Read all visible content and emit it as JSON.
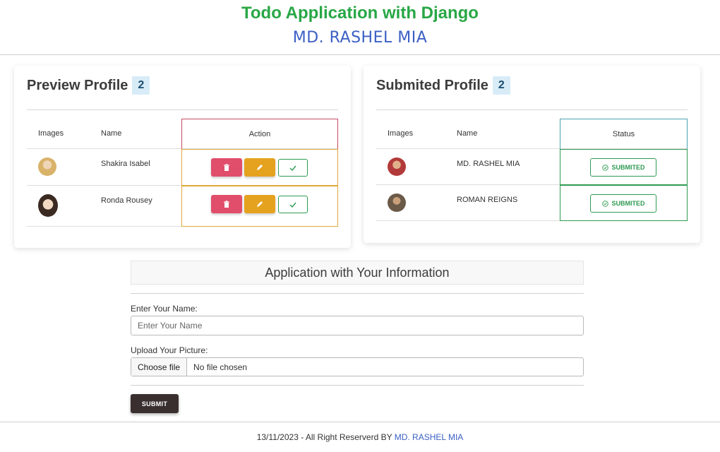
{
  "header": {
    "title": "Todo Application with Django",
    "author": "MD. RASHEL MIA"
  },
  "preview": {
    "title": "Preview Profile",
    "count": "2",
    "columns": [
      "Images",
      "Name",
      "Action"
    ],
    "rows": [
      {
        "name": "Shakira Isabel",
        "avatar_color": "#d9b36a"
      },
      {
        "name": "Ronda Rousey",
        "avatar_color": "#c89a6f"
      }
    ]
  },
  "submitted": {
    "title": "Submited Profile",
    "count": "2",
    "columns": [
      "Images",
      "Name",
      "Status"
    ],
    "rows": [
      {
        "name": "MD. RASHEL MIA",
        "status": "SUBMITED",
        "avatar_color": "#b33a3a"
      },
      {
        "name": "ROMAN REIGNS",
        "status": "SUBMITED",
        "avatar_color": "#6b5a48"
      }
    ]
  },
  "form": {
    "title": "Application with Your Information",
    "name_label": "Enter Your Name:",
    "name_placeholder": "Enter Your Name",
    "picture_label": "Upload Your Picture:",
    "choose_file": "Choose file",
    "no_file": "No file chosen",
    "submit": "SUBMIT"
  },
  "footer": {
    "text": "13/11/2023 - All Right Reserverd BY",
    "link": "MD. RASHEL MIA"
  },
  "colors": {
    "title_green": "#28a745",
    "author_blue": "#3b5fc4",
    "delete_red": "#e04e6b",
    "edit_orange": "#e5a21f",
    "status_green": "#2e9a52"
  }
}
